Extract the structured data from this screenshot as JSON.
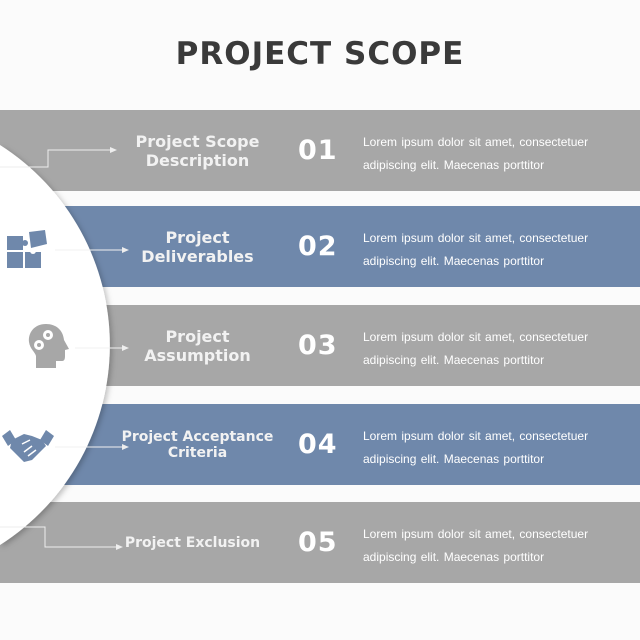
{
  "title": "PROJECT SCOPE",
  "colors": {
    "gray_band": "#a7a7a7",
    "blue_band": "#6f88ab",
    "title": "#3a3a3a"
  },
  "items": [
    {
      "label": "Project Scope Description",
      "number": "01",
      "line1": "Lorem ipsum dolor sit amet, consectetuer",
      "line2": "adipiscing elit. Maecenas porttitor",
      "color": "gray",
      "icon": "none"
    },
    {
      "label": "Project Deliverables",
      "number": "02",
      "line1": "Lorem ipsum dolor sit amet, consectetuer",
      "line2": "adipiscing elit. Maecenas porttitor",
      "color": "blue",
      "icon": "puzzle-icon"
    },
    {
      "label": "Project Assumption",
      "number": "03",
      "line1": "Lorem ipsum dolor sit amet, consectetuer",
      "line2": "adipiscing elit. Maecenas porttitor",
      "color": "gray",
      "icon": "head-gears-icon"
    },
    {
      "label": "Project Acceptance Criteria",
      "number": "04",
      "line1": "Lorem ipsum dolor sit amet, consectetuer",
      "line2": "adipiscing elit. Maecenas porttitor",
      "color": "blue",
      "icon": "handshake-icon"
    },
    {
      "label": "Project Exclusion",
      "number": "05",
      "line1": "Lorem ipsum dolor sit amet, consectetuer",
      "line2": "adipiscing elit. Maecenas porttitor",
      "color": "gray",
      "icon": "none"
    }
  ]
}
